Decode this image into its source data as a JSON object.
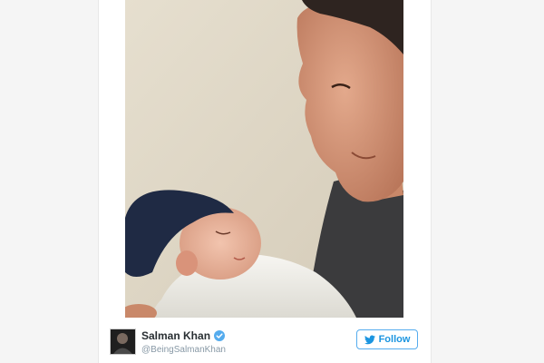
{
  "tweet": {
    "author": {
      "display_name": "Salman Khan",
      "handle": "@BeingSalmanKhan",
      "verified": true,
      "avatar_icon": "profile-avatar"
    },
    "follow_label": "Follow",
    "follow_icon": "twitter-bird-icon",
    "colors": {
      "accent": "#1b95e0",
      "verified": "#55acee",
      "name": "#292f33",
      "handle": "#8899a6"
    }
  }
}
